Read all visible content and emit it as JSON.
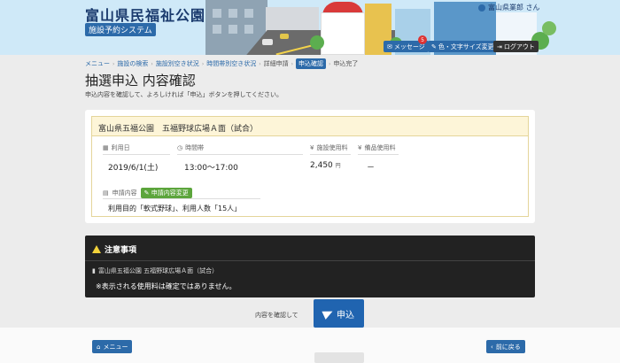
{
  "header": {
    "title": "富山県民福祉公園",
    "subtitle": "施設予約システム",
    "user_name": "富山県業郎 さん",
    "message_label": "メッセージ",
    "message_count": "5",
    "font_label": "色・文字サイズ変更",
    "logout_label": "ログアウト"
  },
  "breadcrumb": {
    "items": [
      "メニュー",
      "施設の検索",
      "施設別空き状況",
      "時間帯別空き状況",
      "詳細申請",
      "申込確認",
      "申込完了"
    ]
  },
  "page": {
    "title": "抽選申込 内容確認",
    "description": "申込内容を確認して、よろしければ「申込」ボタンを押してください。"
  },
  "reservation": {
    "facility": "富山県五福公園　五福野球広場Ａ面（試合）",
    "date_label": "利用日",
    "date": "2019/6/1(土)",
    "time_label": "時間帯",
    "time": "13:00～17:00",
    "fee_label": "施設使用料",
    "fee": "2,450",
    "fee_unit": "円",
    "equip_label": "備品使用料",
    "equip": "－",
    "detail_label": "申請内容",
    "edit_label": "申請内容変更",
    "detail": "利用目的「軟式野球」、利用人数「15人」"
  },
  "notice": {
    "title": "注意事項",
    "facility": "富山県五福公園 五福野球広場Ａ面（試合）",
    "message": "※表示される使用料は確定ではありません。"
  },
  "submit": {
    "prompt": "内容を確認して",
    "label": "申込"
  },
  "footer": {
    "menu_label": "メニュー",
    "back_label": "前に戻る"
  }
}
